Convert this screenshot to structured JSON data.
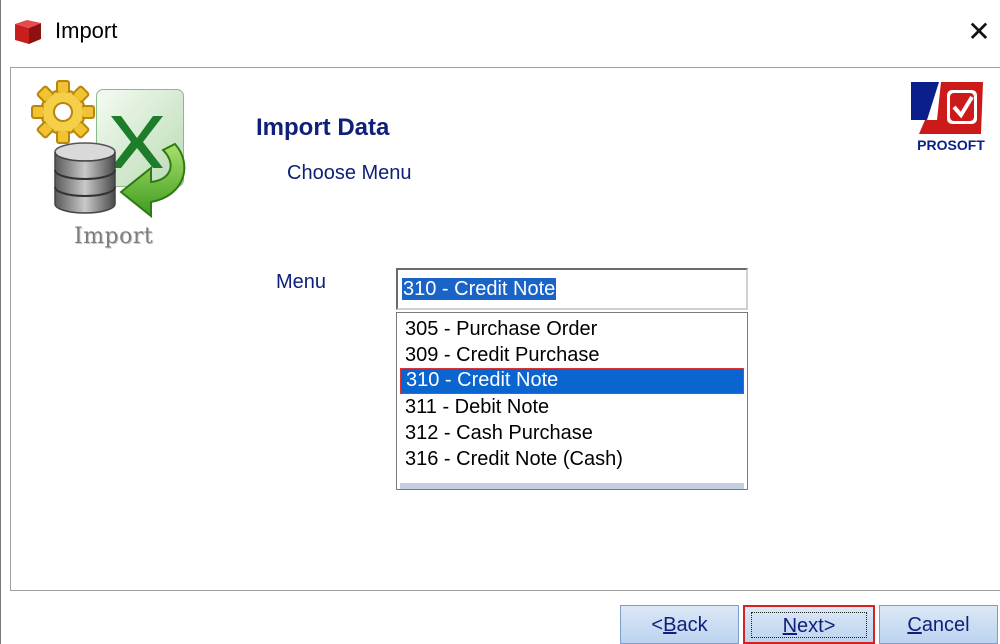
{
  "window": {
    "title": "Import",
    "title_icon": "book-icon",
    "close_icon": "close-icon",
    "close_glyph": "✕"
  },
  "header": {
    "logo_icon": "import-excel-database-icon",
    "logo_caption": "Import",
    "title": "Import Data",
    "subtitle": "Choose Menu",
    "brand_logo": "prosoft-logo",
    "brand_text": "PROSOFT"
  },
  "form": {
    "menu_label": "Menu",
    "menu_value": "310 - Credit Note",
    "menu_options": [
      "305 - Purchase Order",
      "309 - Credit Purchase",
      "310 - Credit Note",
      "311 - Debit Note",
      "312 - Cash Purchase",
      "316 - Credit Note (Cash)"
    ],
    "selected_index": 2
  },
  "buttons": {
    "back_prefix": "<",
    "back_mnemonic": "B",
    "back_rest": "ack",
    "next_mnemonic": "N",
    "next_rest": "ext>",
    "cancel_mnemonic": "C",
    "cancel_rest": "ancel"
  },
  "colors": {
    "accent_text": "#10207a",
    "selection": "#0a65d0",
    "highlight_border": "#d6231f",
    "button_fill": "#c8dbf2"
  }
}
